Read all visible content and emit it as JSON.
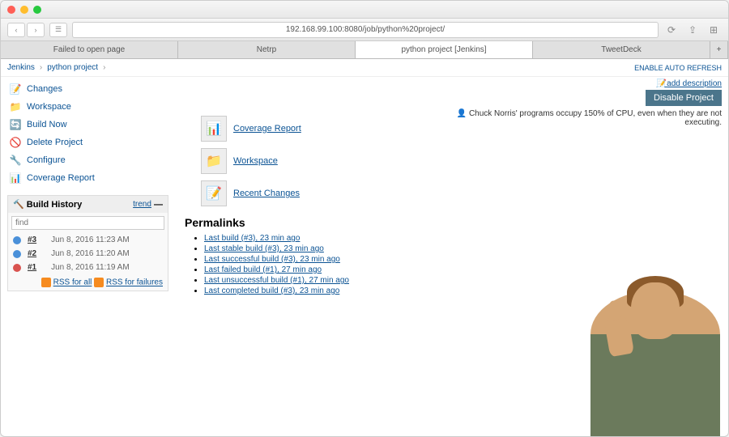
{
  "url": "192.168.99.100:8080/job/python%20project/",
  "tabs": [
    "Failed to open page",
    "Netrp",
    "python project [Jenkins]",
    "TweetDeck"
  ],
  "activeTab": 2,
  "breadcrumb": {
    "root": "Jenkins",
    "project": "python project"
  },
  "autoRefresh": "ENABLE AUTO REFRESH",
  "sidebar": [
    {
      "icon": "📝",
      "label": "Changes",
      "name": "changes"
    },
    {
      "icon": "📁",
      "label": "Workspace",
      "name": "workspace"
    },
    {
      "icon": "🔄",
      "label": "Build Now",
      "name": "build-now"
    },
    {
      "icon": "🚫",
      "label": "Delete Project",
      "name": "delete-project"
    },
    {
      "icon": "🔧",
      "label": "Configure",
      "name": "configure"
    },
    {
      "icon": "📊",
      "label": "Coverage Report",
      "name": "coverage-report"
    }
  ],
  "buildHistory": {
    "title": "Build History",
    "trend": "trend",
    "findPlaceholder": "find",
    "builds": [
      {
        "num": "#3",
        "date": "Jun 8, 2016 11:23 AM",
        "color": "#4a90d9"
      },
      {
        "num": "#2",
        "date": "Jun 8, 2016 11:20 AM",
        "color": "#4a90d9"
      },
      {
        "num": "#1",
        "date": "Jun 8, 2016 11:19 AM",
        "color": "#d9534f"
      }
    ],
    "rssAll": "RSS for all",
    "rssFail": "RSS for failures"
  },
  "topActions": {
    "addDescription": "add description",
    "disableProject": "Disable Project",
    "chuckQuote": "Chuck Norris' programs occupy 150% of CPU, even when they are not executing."
  },
  "mainLinks": [
    {
      "icon": "📊",
      "label": "Coverage Report",
      "name": "coverage-report-main"
    },
    {
      "icon": "📁",
      "label": "Workspace",
      "name": "workspace-main"
    },
    {
      "icon": "📝",
      "label": "Recent Changes",
      "name": "recent-changes-main"
    }
  ],
  "permalinks": {
    "title": "Permalinks",
    "links": [
      "Last build (#3), 23 min ago",
      "Last stable build (#3), 23 min ago",
      "Last successful build (#3), 23 min ago",
      "Last failed build (#1), 27 min ago",
      "Last unsuccessful build (#1), 27 min ago",
      "Last completed build (#3), 23 min ago"
    ]
  }
}
